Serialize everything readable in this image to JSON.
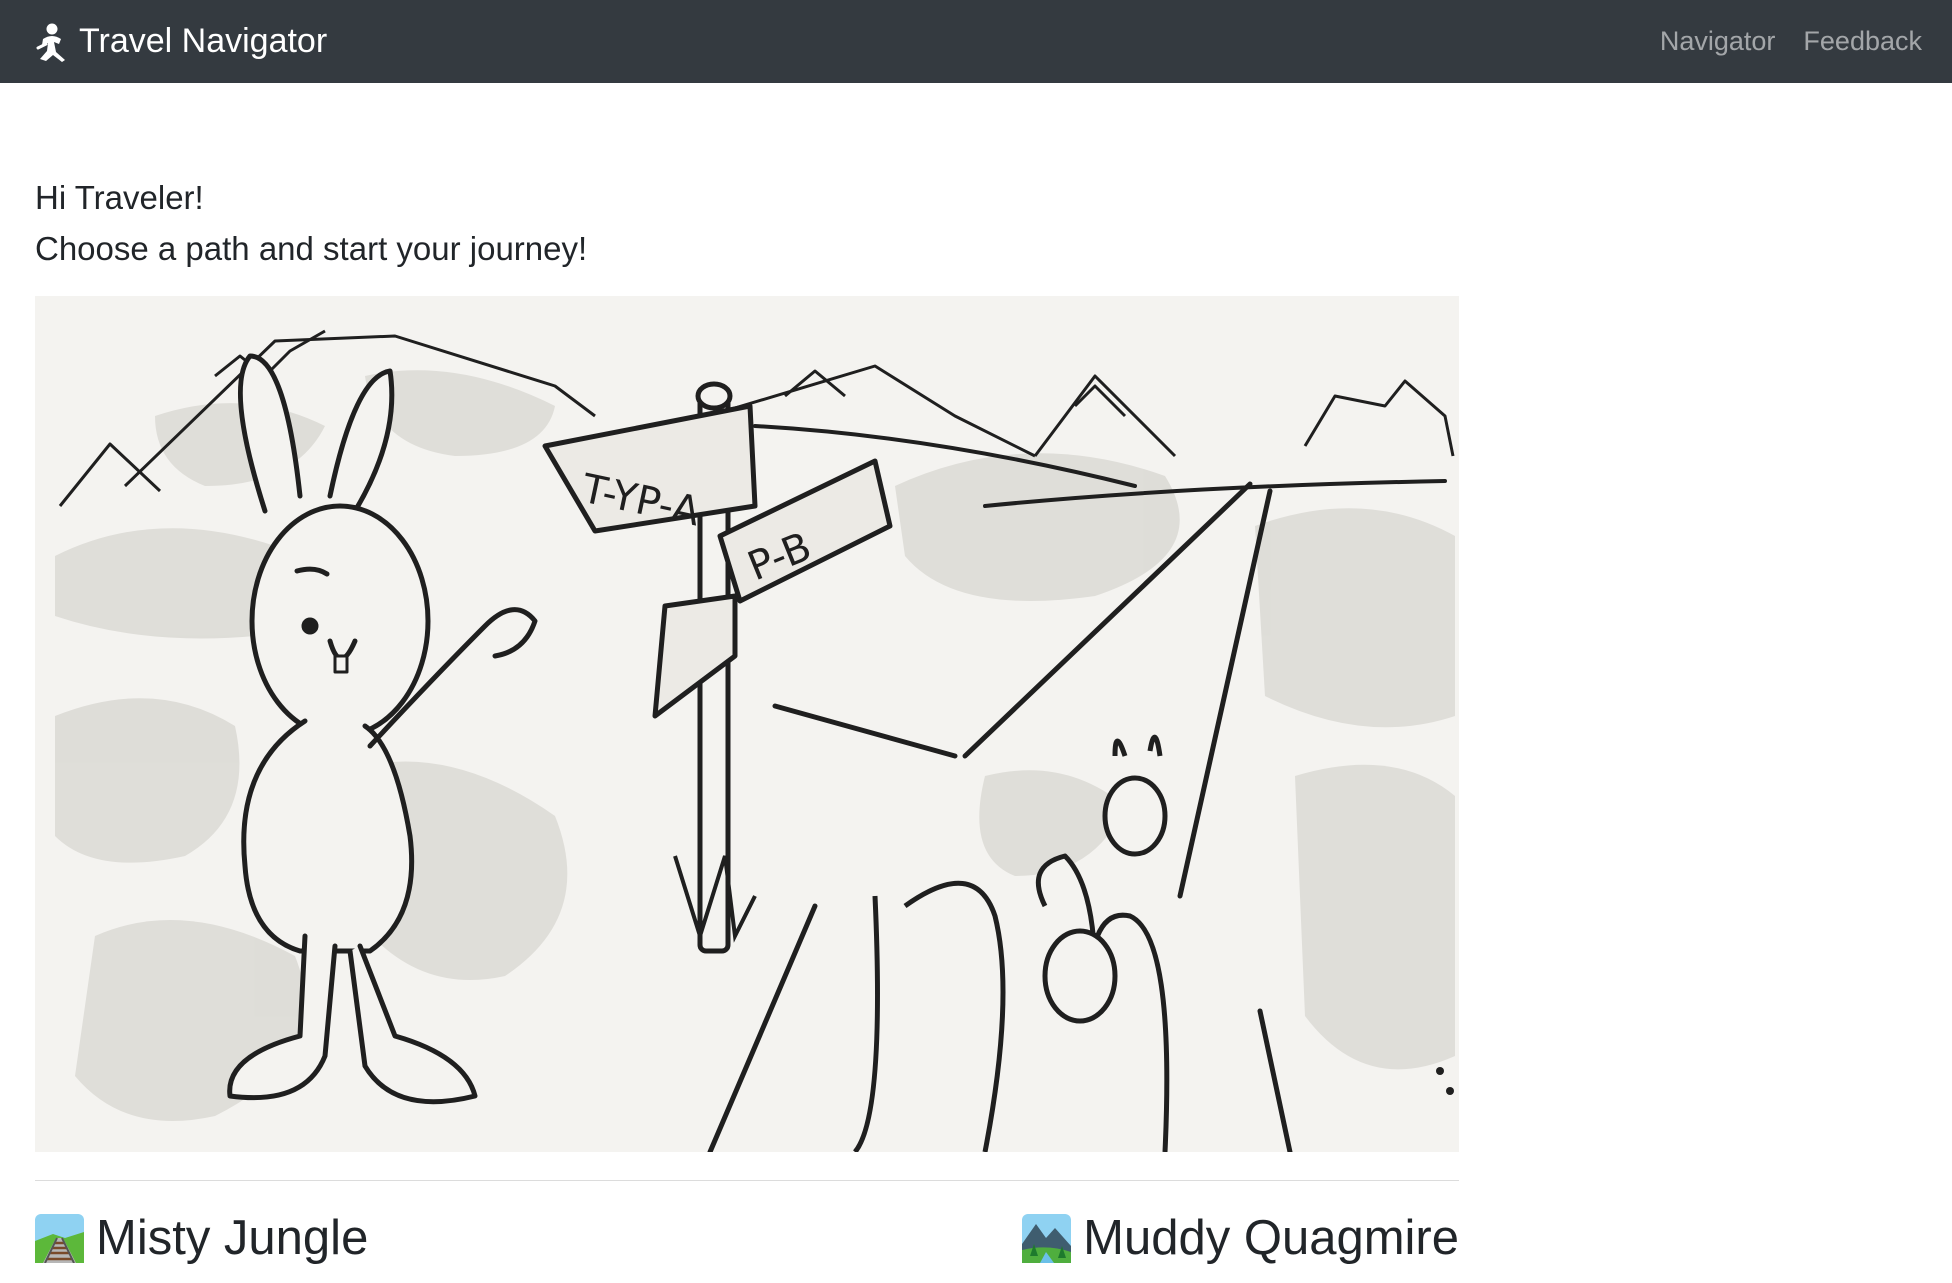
{
  "navbar": {
    "brand_label": "Travel Navigator",
    "brand_icon": "traveler-icon",
    "links": [
      {
        "label": "Navigator"
      },
      {
        "label": "Feedback"
      }
    ]
  },
  "intro": {
    "line1": "Hi Traveler!",
    "line2": "Choose a path and start your journey!"
  },
  "hero": {
    "sign_label_a": "T-YP-A",
    "sign_label_b": "P-B"
  },
  "paths": [
    {
      "label": "Misty Jungle",
      "icon": "railway-track-icon"
    },
    {
      "label": "Muddy Quagmire",
      "icon": "national-park-icon"
    }
  ],
  "colors": {
    "navbar_bg": "#343a40",
    "nav_link": "#9a9da0",
    "text": "#212529",
    "hero_bg": "#f4f3f0"
  }
}
